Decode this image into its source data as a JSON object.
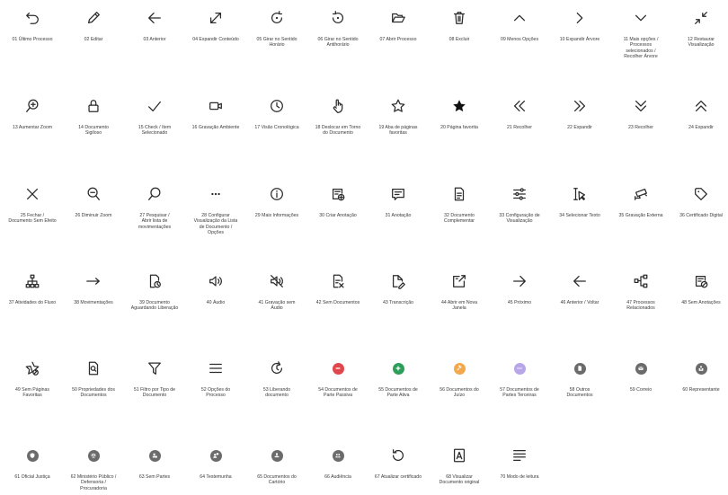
{
  "colors": {
    "icon": "#2b2b2b",
    "red": "#e0474c",
    "green": "#2e9e5b",
    "orange": "#f3a84b",
    "purple": "#b7a6e8",
    "gray": "#6b6b6b"
  },
  "icons": [
    {
      "id": "01",
      "label": "01 Último Processo",
      "icon": "undo-icon"
    },
    {
      "id": "02",
      "label": "02 Editar",
      "icon": "pencil-icon"
    },
    {
      "id": "03",
      "label": "03 Anterior",
      "icon": "arrow-left-icon"
    },
    {
      "id": "04",
      "label": "04 Expandir Conteúdo",
      "icon": "expand-diagonal-icon"
    },
    {
      "id": "05",
      "label": "05 Girar no Sentido\nHorário",
      "icon": "rotate-clockwise-icon"
    },
    {
      "id": "06",
      "label": "06 Girar no Sentido\nAntihorário",
      "icon": "rotate-counterclockwise-icon"
    },
    {
      "id": "07",
      "label": "07 Abrir Processo",
      "icon": "folder-open-icon"
    },
    {
      "id": "08",
      "label": "08 Excluir",
      "icon": "trash-icon"
    },
    {
      "id": "09",
      "label": "09 Menos Opções",
      "icon": "chevron-up-icon"
    },
    {
      "id": "10",
      "label": "10 Expandir Árvore",
      "icon": "chevron-right-icon"
    },
    {
      "id": "11",
      "label": "11 Mais opções /\nProcessos\nselecionados /\nRecolher Árvore",
      "icon": "chevron-down-icon"
    },
    {
      "id": "12",
      "label": "12 Restaurar\nVisualização",
      "icon": "collapse-diagonal-icon"
    },
    {
      "id": "13",
      "label": "13 Aumentar Zoom",
      "icon": "zoom-in-icon"
    },
    {
      "id": "14",
      "label": "14 Documento\nSigiloso",
      "icon": "lock-icon"
    },
    {
      "id": "15",
      "label": "15 Check / Item\nSelecionado",
      "icon": "check-icon"
    },
    {
      "id": "16",
      "label": "16 Gravação Ambiente",
      "icon": "video-camera-icon"
    },
    {
      "id": "17",
      "label": "17 Visão Cronológica",
      "icon": "clock-icon"
    },
    {
      "id": "18",
      "label": "18 Deslocar em Torno\ndo Documento",
      "icon": "hand-pointer-icon"
    },
    {
      "id": "19",
      "label": "19 Aba de páginas\nfavoritas",
      "icon": "star-outline-icon"
    },
    {
      "id": "20",
      "label": "20 Página favorita",
      "icon": "star-filled-icon"
    },
    {
      "id": "21",
      "label": "21 Recolher",
      "icon": "double-chevron-left-icon"
    },
    {
      "id": "22",
      "label": "22 Expandir",
      "icon": "double-chevron-right-icon"
    },
    {
      "id": "23",
      "label": "23 Recolher",
      "icon": "double-chevron-down-icon"
    },
    {
      "id": "24",
      "label": "24 Expandir",
      "icon": "double-chevron-up-icon"
    },
    {
      "id": "25",
      "label": "25 Fechar /\nDocumento Sem Efeito",
      "icon": "close-icon"
    },
    {
      "id": "26",
      "label": "26 Diminuir Zoom",
      "icon": "zoom-out-icon"
    },
    {
      "id": "27",
      "label": "27 Pesquisar /\nAbrir lista de\nmovimentações",
      "icon": "search-icon"
    },
    {
      "id": "28",
      "label": "28 Configurar\nVisualização da Lista\nde Documento /\nOpções",
      "icon": "more-horizontal-icon"
    },
    {
      "id": "29",
      "label": "29 Mais Informações",
      "icon": "info-icon"
    },
    {
      "id": "30",
      "label": "30 Criar Anotação",
      "icon": "note-add-icon"
    },
    {
      "id": "31",
      "label": "31 Anotação",
      "icon": "comment-icon"
    },
    {
      "id": "32",
      "label": "32 Documento\nComplementar",
      "icon": "document-icon"
    },
    {
      "id": "33",
      "label": "33 Configuração de\nVisualização",
      "icon": "sliders-icon"
    },
    {
      "id": "34",
      "label": "34 Selecionar Texto",
      "icon": "text-select-icon"
    },
    {
      "id": "35",
      "label": "35 Gravação Externa",
      "icon": "security-camera-icon"
    },
    {
      "id": "36",
      "label": "36 Certificado Digital",
      "icon": "tag-icon"
    },
    {
      "id": "37",
      "label": "37 Atividades do Fluxo",
      "icon": "org-chart-icon"
    },
    {
      "id": "38",
      "label": "38 Movimentações",
      "icon": "arrow-right-bar-icon"
    },
    {
      "id": "39",
      "label": "39 Documento\nAguardando Liberação",
      "icon": "document-clock-icon"
    },
    {
      "id": "40",
      "label": "40 Áudio",
      "icon": "speaker-icon"
    },
    {
      "id": "41",
      "label": "41 Gravação sem\nÁudio",
      "icon": "speaker-muted-icon"
    },
    {
      "id": "42",
      "label": "42 Sem Documentos",
      "icon": "document-off-icon"
    },
    {
      "id": "43",
      "label": "43 Transcrição",
      "icon": "transcription-icon"
    },
    {
      "id": "44",
      "label": "44 Abrir em Nova\nJanela",
      "icon": "open-new-window-icon"
    },
    {
      "id": "45",
      "label": "45 Próximo",
      "icon": "arrow-right-icon"
    },
    {
      "id": "46",
      "label": "46 Anterior / Voltar",
      "icon": "arrow-left-icon"
    },
    {
      "id": "47",
      "label": "47 Processos\nRelacionados",
      "icon": "related-processes-icon"
    },
    {
      "id": "48",
      "label": "48 Sem Anotações",
      "icon": "note-off-icon"
    },
    {
      "id": "49",
      "label": "49 Sem Páginas\nFavoritas",
      "icon": "star-off-icon"
    },
    {
      "id": "50",
      "label": "50 Propriedades dos\nDocumentos",
      "icon": "document-search-icon"
    },
    {
      "id": "51",
      "label": "51 Filtro por Tipo de\nDocumento",
      "icon": "filter-icon"
    },
    {
      "id": "52",
      "label": "52 Opções do\nProcesso",
      "icon": "menu-icon"
    },
    {
      "id": "53",
      "label": "53 Liberando\ndocumento",
      "icon": "refresh-icon"
    },
    {
      "id": "54",
      "label": "54 Documentos de\nParte Passiva",
      "icon": "minus-circle-icon"
    },
    {
      "id": "55",
      "label": "55 Documentos de\nParte Ativa",
      "icon": "plus-circle-icon"
    },
    {
      "id": "56",
      "label": "56 Documentos do\nJuízo",
      "icon": "gavel-circle-icon"
    },
    {
      "id": "57",
      "label": "57 Documentos de\nPartes Terceiras",
      "icon": "ellipsis-circle-icon"
    },
    {
      "id": "58",
      "label": "58 Outros\nDocumentos",
      "icon": "document-circle-icon"
    },
    {
      "id": "59",
      "label": "59 Correio",
      "icon": "mail-circle-icon"
    },
    {
      "id": "60",
      "label": "60 Representante",
      "icon": "people-circle-icon"
    },
    {
      "id": "61",
      "label": "61 Oficial Justiça",
      "icon": "shield-circle-icon"
    },
    {
      "id": "62",
      "label": "62 Ministério Público /\nDefensoria /\nProcuradoria",
      "icon": "scales-circle-icon"
    },
    {
      "id": "63",
      "label": "63 Sem Partes",
      "icon": "person-off-circle-icon"
    },
    {
      "id": "64",
      "label": "64 Testemunha",
      "icon": "person-speech-circle-icon"
    },
    {
      "id": "65",
      "label": "65 Documentos do\nCartório",
      "icon": "stamp-circle-icon"
    },
    {
      "id": "66",
      "label": "66 Audiência",
      "icon": "group-circle-icon"
    },
    {
      "id": "67",
      "label": "67 Atualizar certificado",
      "icon": "refresh-ccw-icon"
    },
    {
      "id": "68",
      "label": "68 Visualizar\nDocumento original",
      "icon": "pdf-icon"
    },
    {
      "id": "70",
      "label": "70 Modo de leitura",
      "icon": "reading-mode-icon"
    }
  ]
}
